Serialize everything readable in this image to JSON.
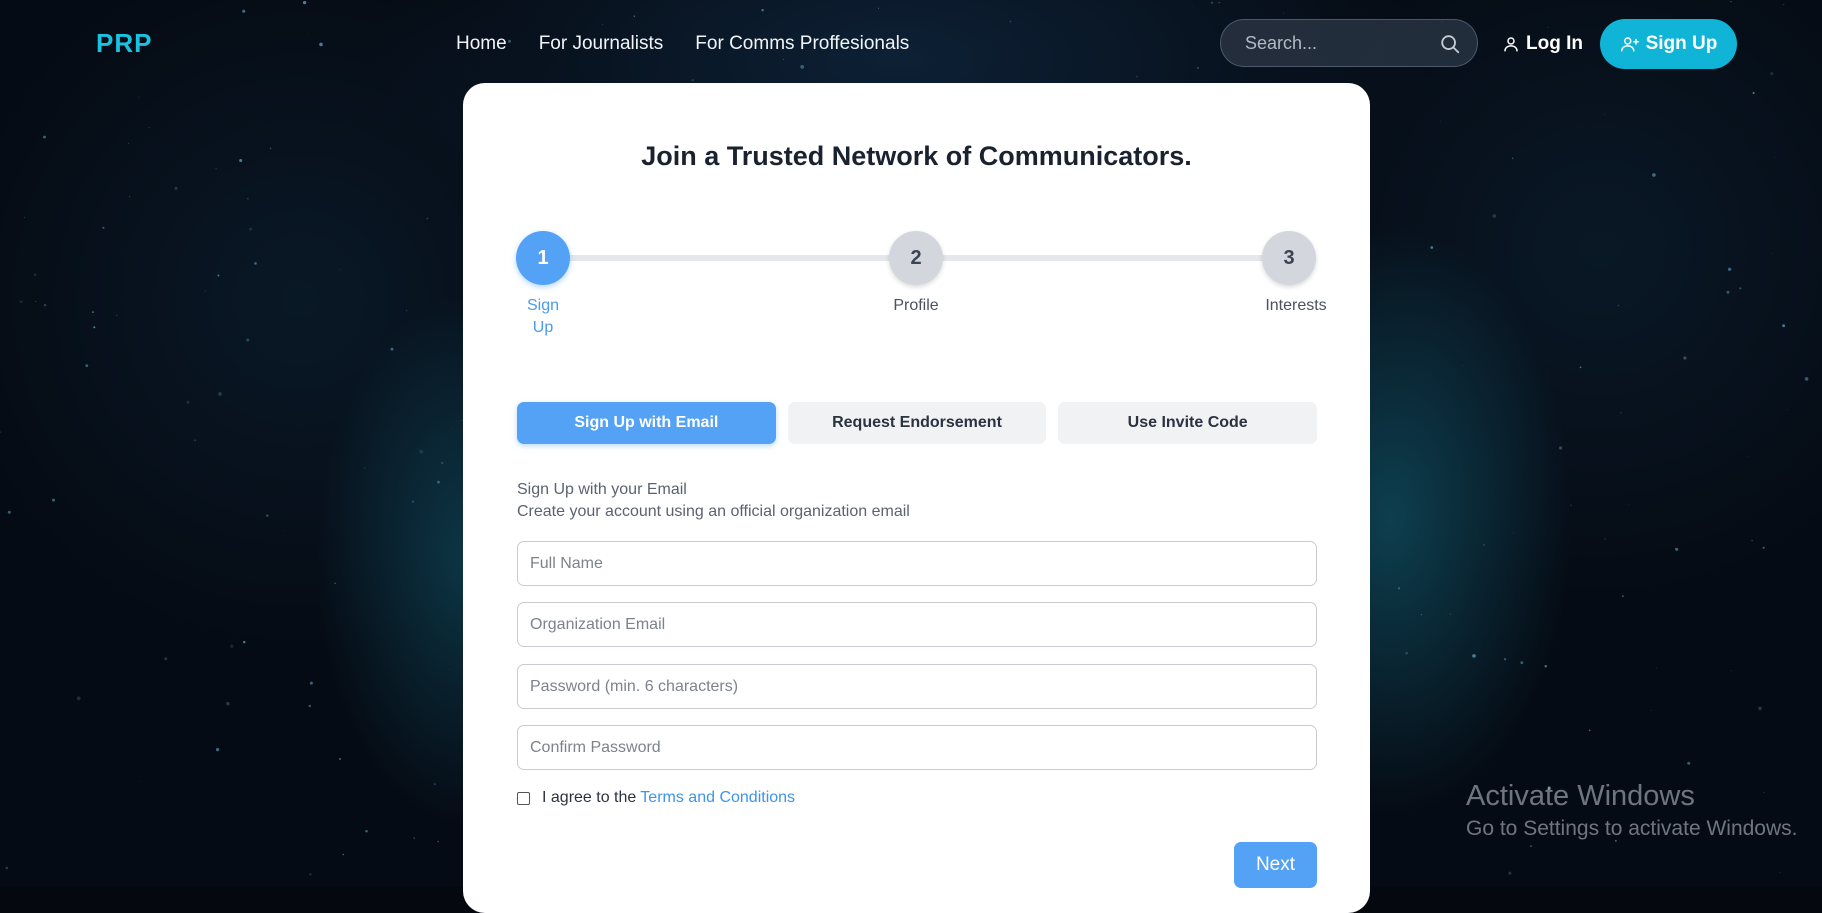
{
  "header": {
    "logo": "PRP",
    "nav": [
      "Home",
      "For Journalists",
      "For Comms Proffesionals"
    ],
    "search_placeholder": "Search...",
    "login_label": "Log In",
    "signup_label": "Sign Up"
  },
  "card": {
    "title": "Join a Trusted Network of Communicators.",
    "steps": [
      {
        "number": "1",
        "label": "Sign Up",
        "active": true
      },
      {
        "number": "2",
        "label": "Profile",
        "active": false
      },
      {
        "number": "3",
        "label": "Interests",
        "active": false
      }
    ],
    "tabs": [
      {
        "label": "Sign Up with Email",
        "active": true
      },
      {
        "label": "Request Endorsement",
        "active": false
      },
      {
        "label": "Use Invite Code",
        "active": false
      }
    ],
    "intro_title": "Sign Up with your Email",
    "intro_subtitle": "Create your account using an official organization email",
    "fields": {
      "full_name": {
        "placeholder": "Full Name",
        "value": ""
      },
      "org_email": {
        "placeholder": "Organization Email",
        "value": ""
      },
      "password": {
        "placeholder": "Password (min. 6 characters)",
        "value": ""
      },
      "confirm_password": {
        "placeholder": "Confirm Password",
        "value": ""
      }
    },
    "terms": {
      "prefix": "I agree to the",
      "link": "Terms and Conditions",
      "checked": false
    },
    "next_label": "Next"
  },
  "watermark": {
    "line1": "Activate Windows",
    "line2": "Go to Settings to activate Windows."
  },
  "colors": {
    "accent": "#54a2f5",
    "brand": "#10b4d6",
    "logo": "#19c3e0"
  }
}
